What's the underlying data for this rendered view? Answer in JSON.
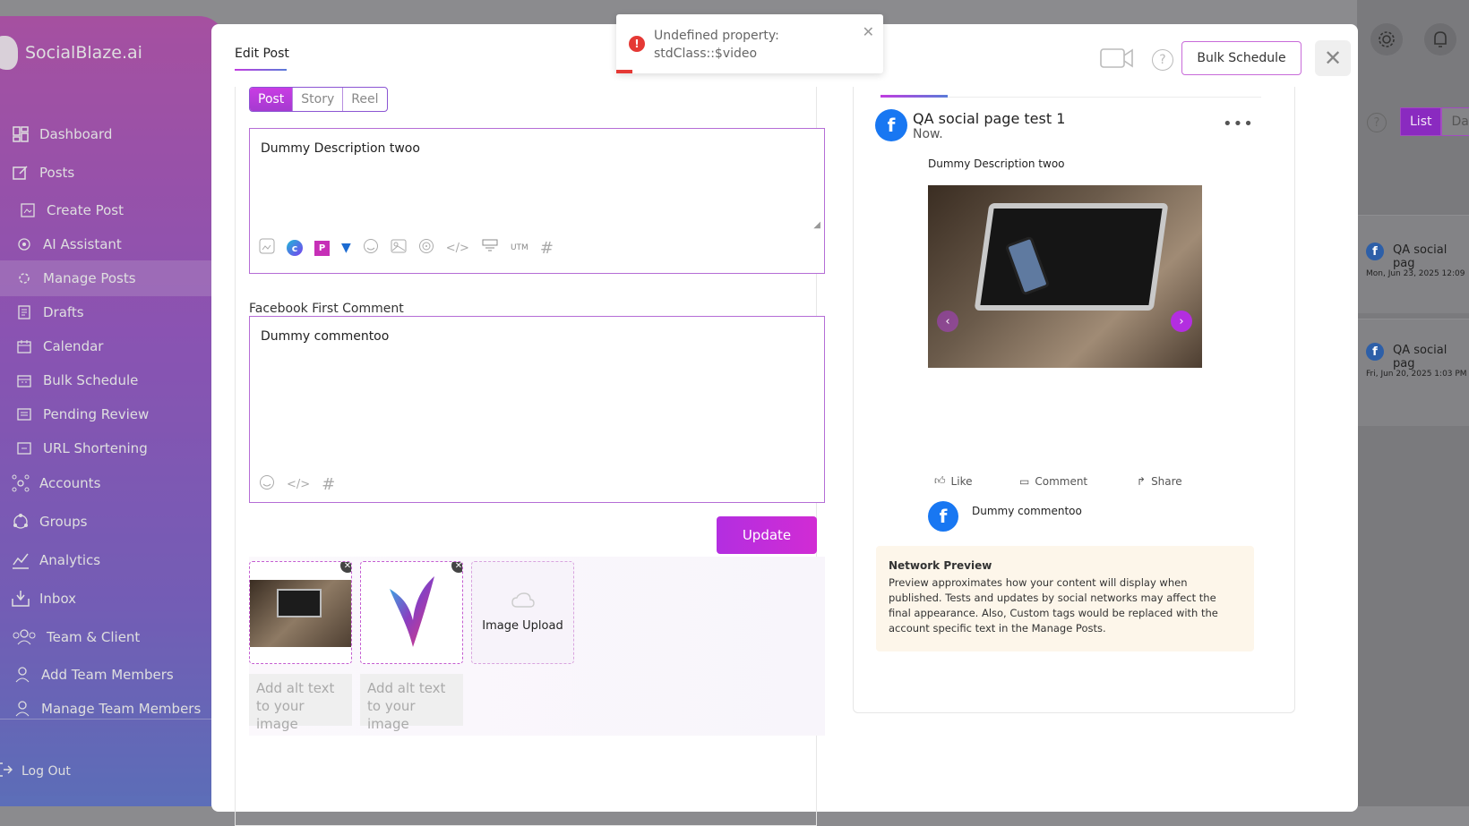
{
  "app": {
    "name": "SocialBlaze.ai"
  },
  "sidebar": {
    "items": [
      {
        "label": "Dashboard",
        "icon": "dashboard-icon"
      },
      {
        "label": "Posts",
        "icon": "posts-icon"
      },
      {
        "label": "Create Post",
        "icon": "create-post-icon"
      },
      {
        "label": "AI Assistant",
        "icon": "ai-assistant-icon"
      },
      {
        "label": "Manage Posts",
        "icon": "manage-posts-icon"
      },
      {
        "label": "Drafts",
        "icon": "drafts-icon"
      },
      {
        "label": "Calendar",
        "icon": "calendar-icon"
      },
      {
        "label": "Bulk Schedule",
        "icon": "bulk-schedule-icon"
      },
      {
        "label": "Pending Review",
        "icon": "pending-review-icon"
      },
      {
        "label": "URL Shortening",
        "icon": "url-shortening-icon"
      },
      {
        "label": "Accounts",
        "icon": "accounts-icon"
      },
      {
        "label": "Groups",
        "icon": "groups-icon"
      },
      {
        "label": "Analytics",
        "icon": "analytics-icon"
      },
      {
        "label": "Inbox",
        "icon": "inbox-icon"
      },
      {
        "label": "Team & Client",
        "icon": "team-client-icon"
      },
      {
        "label": "Add Team Members",
        "icon": "add-team-members-icon"
      },
      {
        "label": "Manage Team Members",
        "icon": "manage-team-members-icon"
      }
    ],
    "logout": "Log Out"
  },
  "background": {
    "list_tab": "List",
    "day_tab": "Day",
    "cards": [
      {
        "name": "QA social pag",
        "time": "Mon, Jun 23, 2025 12:09"
      },
      {
        "name": "QA social pag",
        "time": "Fri, Jun 20, 2025 1:03 PM"
      }
    ]
  },
  "modal": {
    "tab": "Edit Post",
    "bulk_schedule": "Bulk Schedule",
    "type_tabs": [
      "Post",
      "Story",
      "Reel"
    ],
    "description": "Dummy Description twoo",
    "utm_label": "UTM",
    "first_comment_label": "Facebook First Comment",
    "first_comment": "Dummy commentoo",
    "update_button": "Update",
    "image_upload": "Image Upload",
    "alt_placeholder": "Add alt text to your image"
  },
  "preview": {
    "page_name": "QA social page test 1",
    "time": "Now.",
    "description": "Dummy Description twoo",
    "actions": [
      "Like",
      "Comment",
      "Share"
    ],
    "comment": "Dummy commentoo",
    "notice_title": "Network Preview",
    "notice_text": "Preview approximates how your content will display when published. Tests and updates by social networks may affect the final appearance. Also, Custom tags would be replaced with the account specific text in the Manage Posts."
  },
  "toast": {
    "message": "Undefined property: stdClass::$video"
  },
  "colors": {
    "accent": "#b32ee0",
    "brand_blue": "#1877f2",
    "error": "#e53935"
  }
}
